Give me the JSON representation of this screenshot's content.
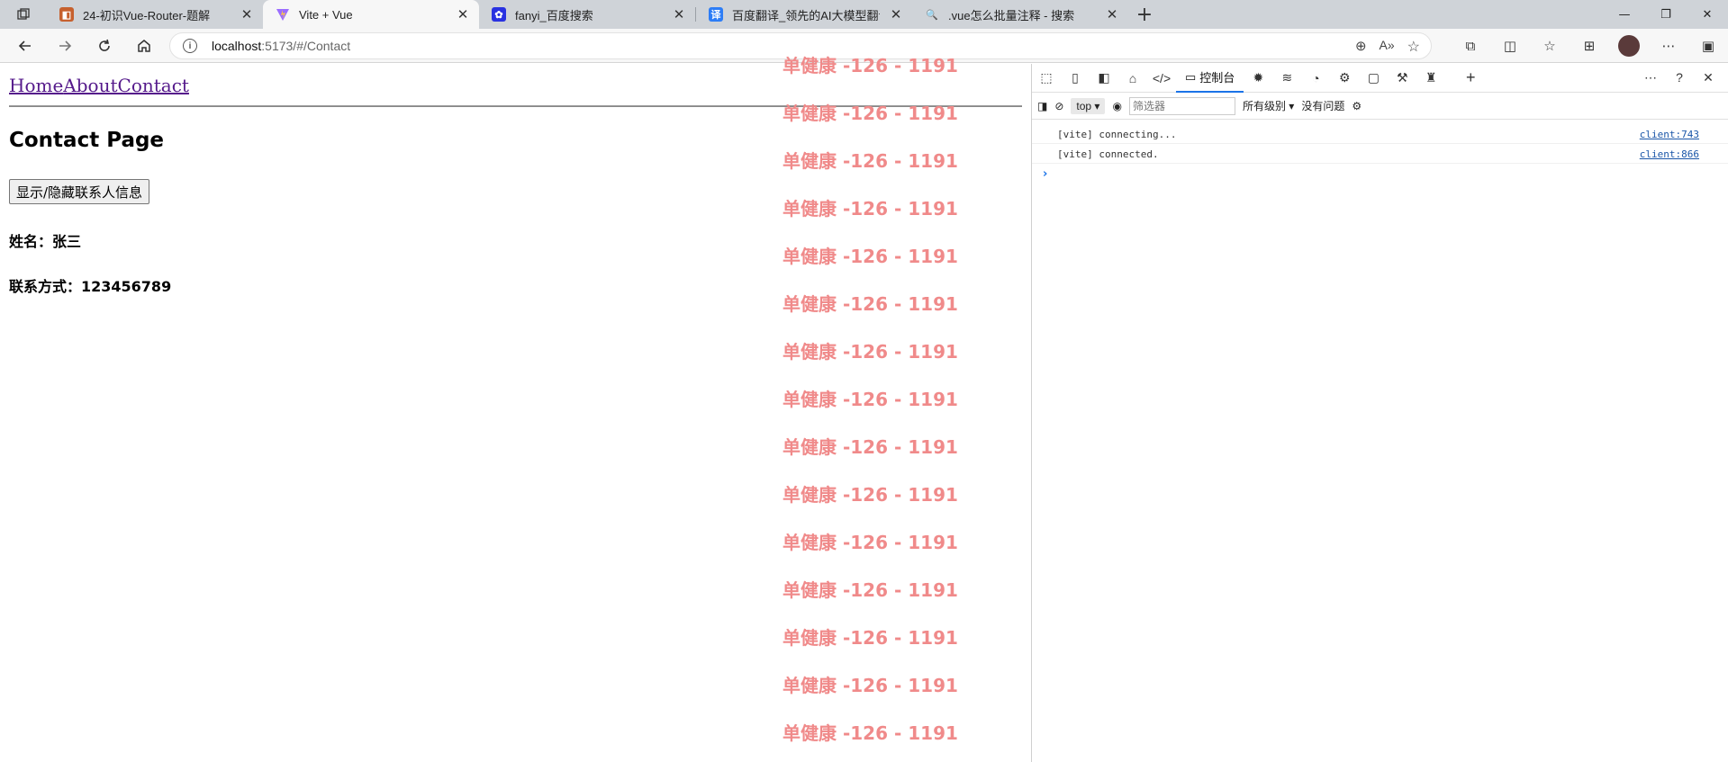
{
  "browser": {
    "tabs": [
      {
        "title": "24-初识Vue-Router-题解",
        "icon": "page-icon",
        "active": false
      },
      {
        "title": "Vite + Vue",
        "icon": "vite-icon",
        "active": true
      },
      {
        "title": "fanyi_百度搜索",
        "icon": "baidu-icon",
        "active": false
      },
      {
        "title": "百度翻译_领先的AI大模型翻译_文",
        "icon": "baidu-translate-icon",
        "active": false
      },
      {
        "title": ".vue怎么批量注释 - 搜索",
        "icon": "bing-search-icon",
        "active": false
      }
    ],
    "url_host": "localhost",
    "url_path": ":5173/#/Contact"
  },
  "page": {
    "nav_links": [
      "Home",
      "About",
      "Contact"
    ],
    "title": "Contact Page",
    "toggle_button": "显示/隐藏联系人信息",
    "name_line": "姓名：张三",
    "contact_line": "联系方式：123456789",
    "watermark": "单健康 -126 - 1191",
    "watermark_color": "#f08a8a"
  },
  "devtools": {
    "active_tab": "控制台",
    "context": "top",
    "filter_placeholder": "筛选器",
    "levels": "所有级别",
    "issues": "没有问题",
    "logs": [
      {
        "text": "[vite] connecting...",
        "source": "client:743"
      },
      {
        "text": "[vite] connected.",
        "source": "client:866"
      }
    ]
  }
}
